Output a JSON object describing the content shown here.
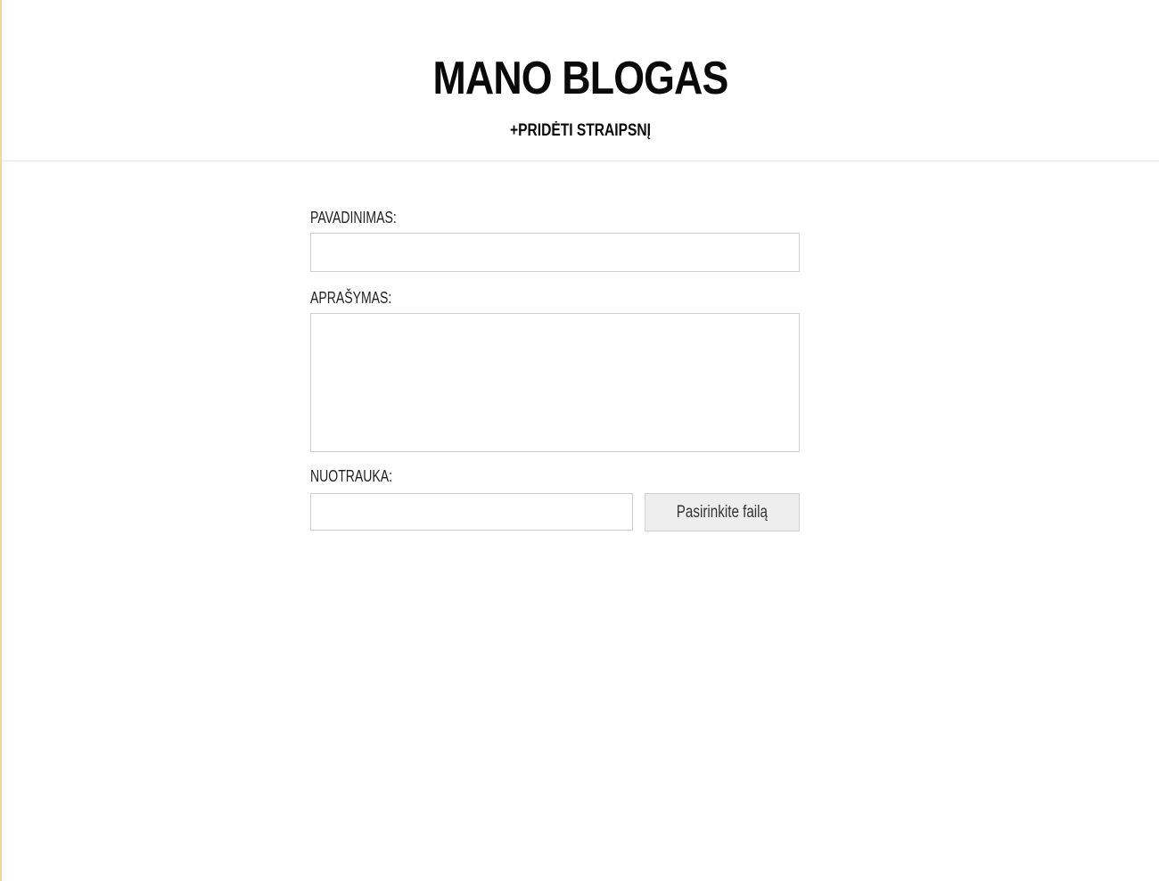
{
  "header": {
    "title": "MANO BLOGAS",
    "add_post_link": "+PRIDĖTI STRAIPSNĮ"
  },
  "form": {
    "title_label": "PAVADINIMAS:",
    "title_value": "",
    "description_label": "APRAŠYMAS:",
    "description_value": "",
    "image_label": "NUOTRAUKA:",
    "image_value": "",
    "choose_file_button": "Pasirinkite failą"
  },
  "colors": {
    "left_accent": "#f3d6a4",
    "button_background": "#eeeeee",
    "input_border": "#cfcfcf"
  }
}
